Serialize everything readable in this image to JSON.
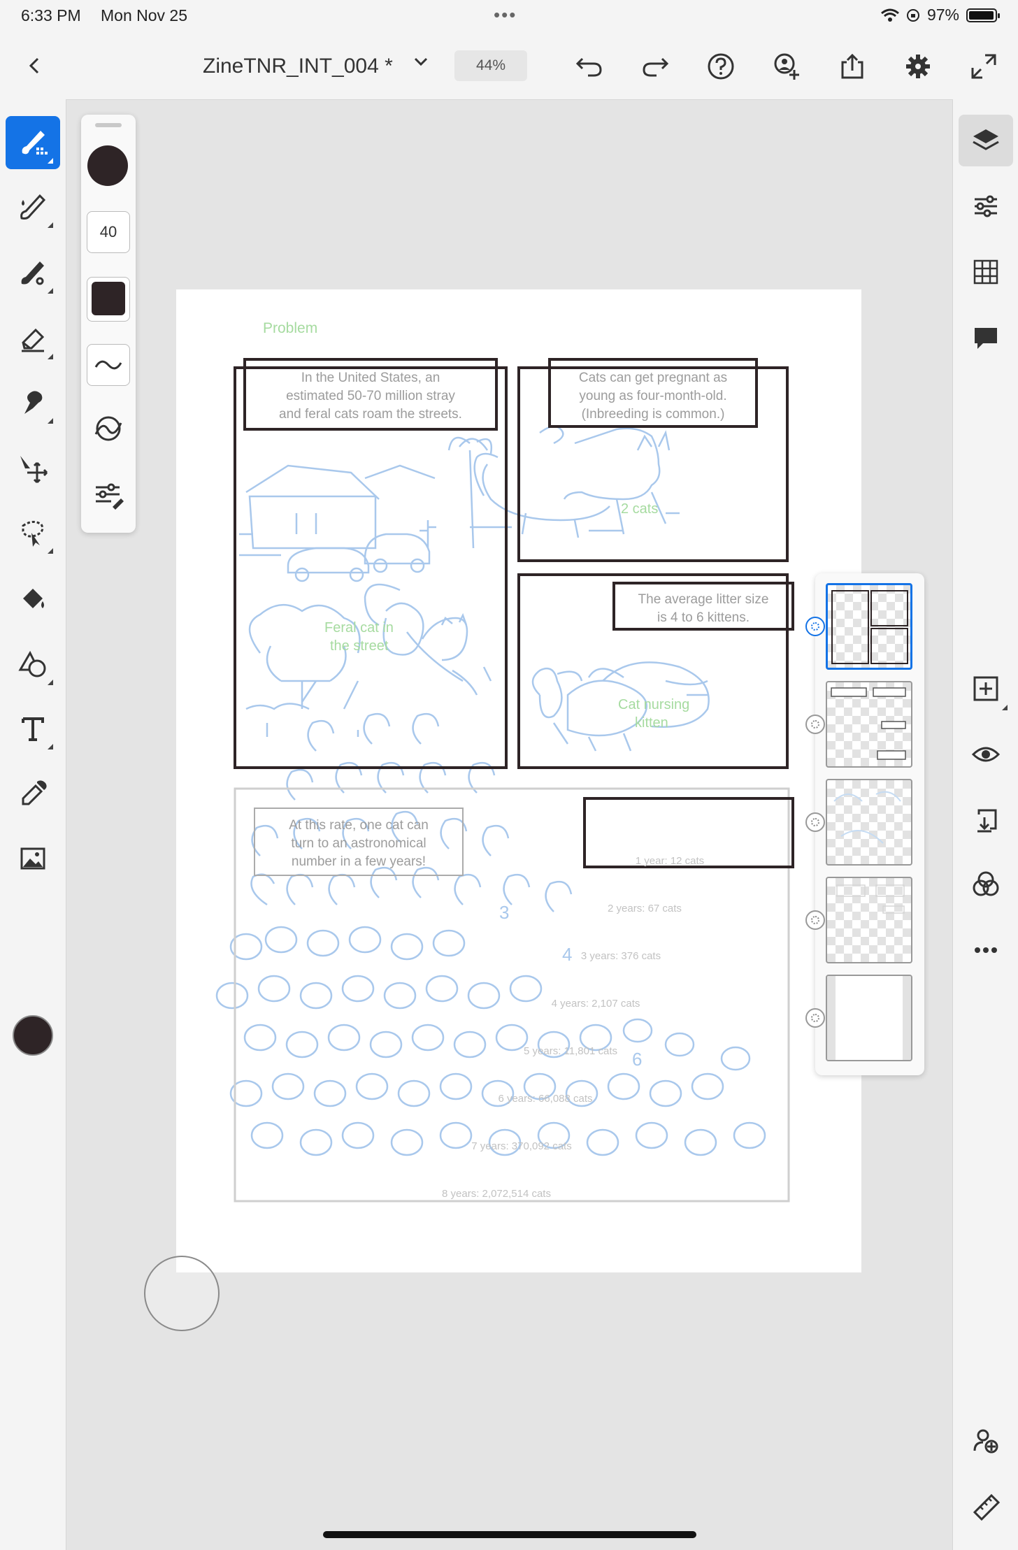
{
  "status": {
    "time": "6:33 PM",
    "date": "Mon Nov 25",
    "battery": "97%",
    "battery_level": 0.97
  },
  "appbar": {
    "back_icon": "chevron-left-icon",
    "doc_title": "ZineTNR_INT_004 *",
    "zoom": "44%",
    "icons": [
      "undo-icon",
      "redo-icon",
      "help-icon",
      "invite-icon",
      "share-icon",
      "settings-icon",
      "fullscreen-icon"
    ]
  },
  "left_tools": [
    "pixel-brush-icon",
    "live-brush-icon",
    "vector-brush-icon",
    "eraser-icon",
    "smudge-icon",
    "transform-icon",
    "selection-icon",
    "fill-icon",
    "shape-icon",
    "text-icon",
    "eyedropper-icon",
    "image-icon"
  ],
  "brush_panel": {
    "size": "40",
    "color": "#2e2426"
  },
  "right_tools": [
    "layers-icon",
    "adjustments-icon",
    "grid-icon",
    "comments-icon",
    "add-layer-icon",
    "visibility-icon",
    "merge-icon",
    "blend-icon",
    "more-icon",
    "collab-icon",
    "ruler-icon"
  ],
  "canvas": {
    "problem_label": "Problem",
    "panel1_text": [
      "In the United States, an",
      "estimated 50-70 million stray",
      "and feral cats roam the streets."
    ],
    "panel2_text": [
      "Cats can get pregnant as",
      "young as four-month-old.",
      "(Inbreeding is common.)"
    ],
    "panel2_note": "2 cats",
    "panel3_note": [
      "Feral cat in",
      "the street"
    ],
    "panel4_text": [
      "The average litter size",
      "is 4 to 6 kittens."
    ],
    "panel4_note": [
      "Cat nursing",
      "kitten"
    ],
    "panel5_text": [
      "At this rate, one cat can",
      "turn to an astronomical",
      "number in a few years!"
    ],
    "growth": [
      "1 year: 12 cats",
      "2 years: 67 cats",
      "3 years: 376 cats",
      "4 years: 2,107 cats",
      "5 years: 11,801 cats",
      "6 years: 66,088 cats",
      "7 years: 370,092 cats",
      "8 years: 2,072,514 cats"
    ],
    "sketch_numbers": [
      "3",
      "4",
      "6"
    ]
  },
  "layers": {
    "count": 5,
    "active_index": 0
  },
  "colors": {
    "accent": "#1473e6",
    "sketch_blue": "#a9c8ec",
    "note_green": "#a6dba0",
    "ink": "#2e2426"
  }
}
